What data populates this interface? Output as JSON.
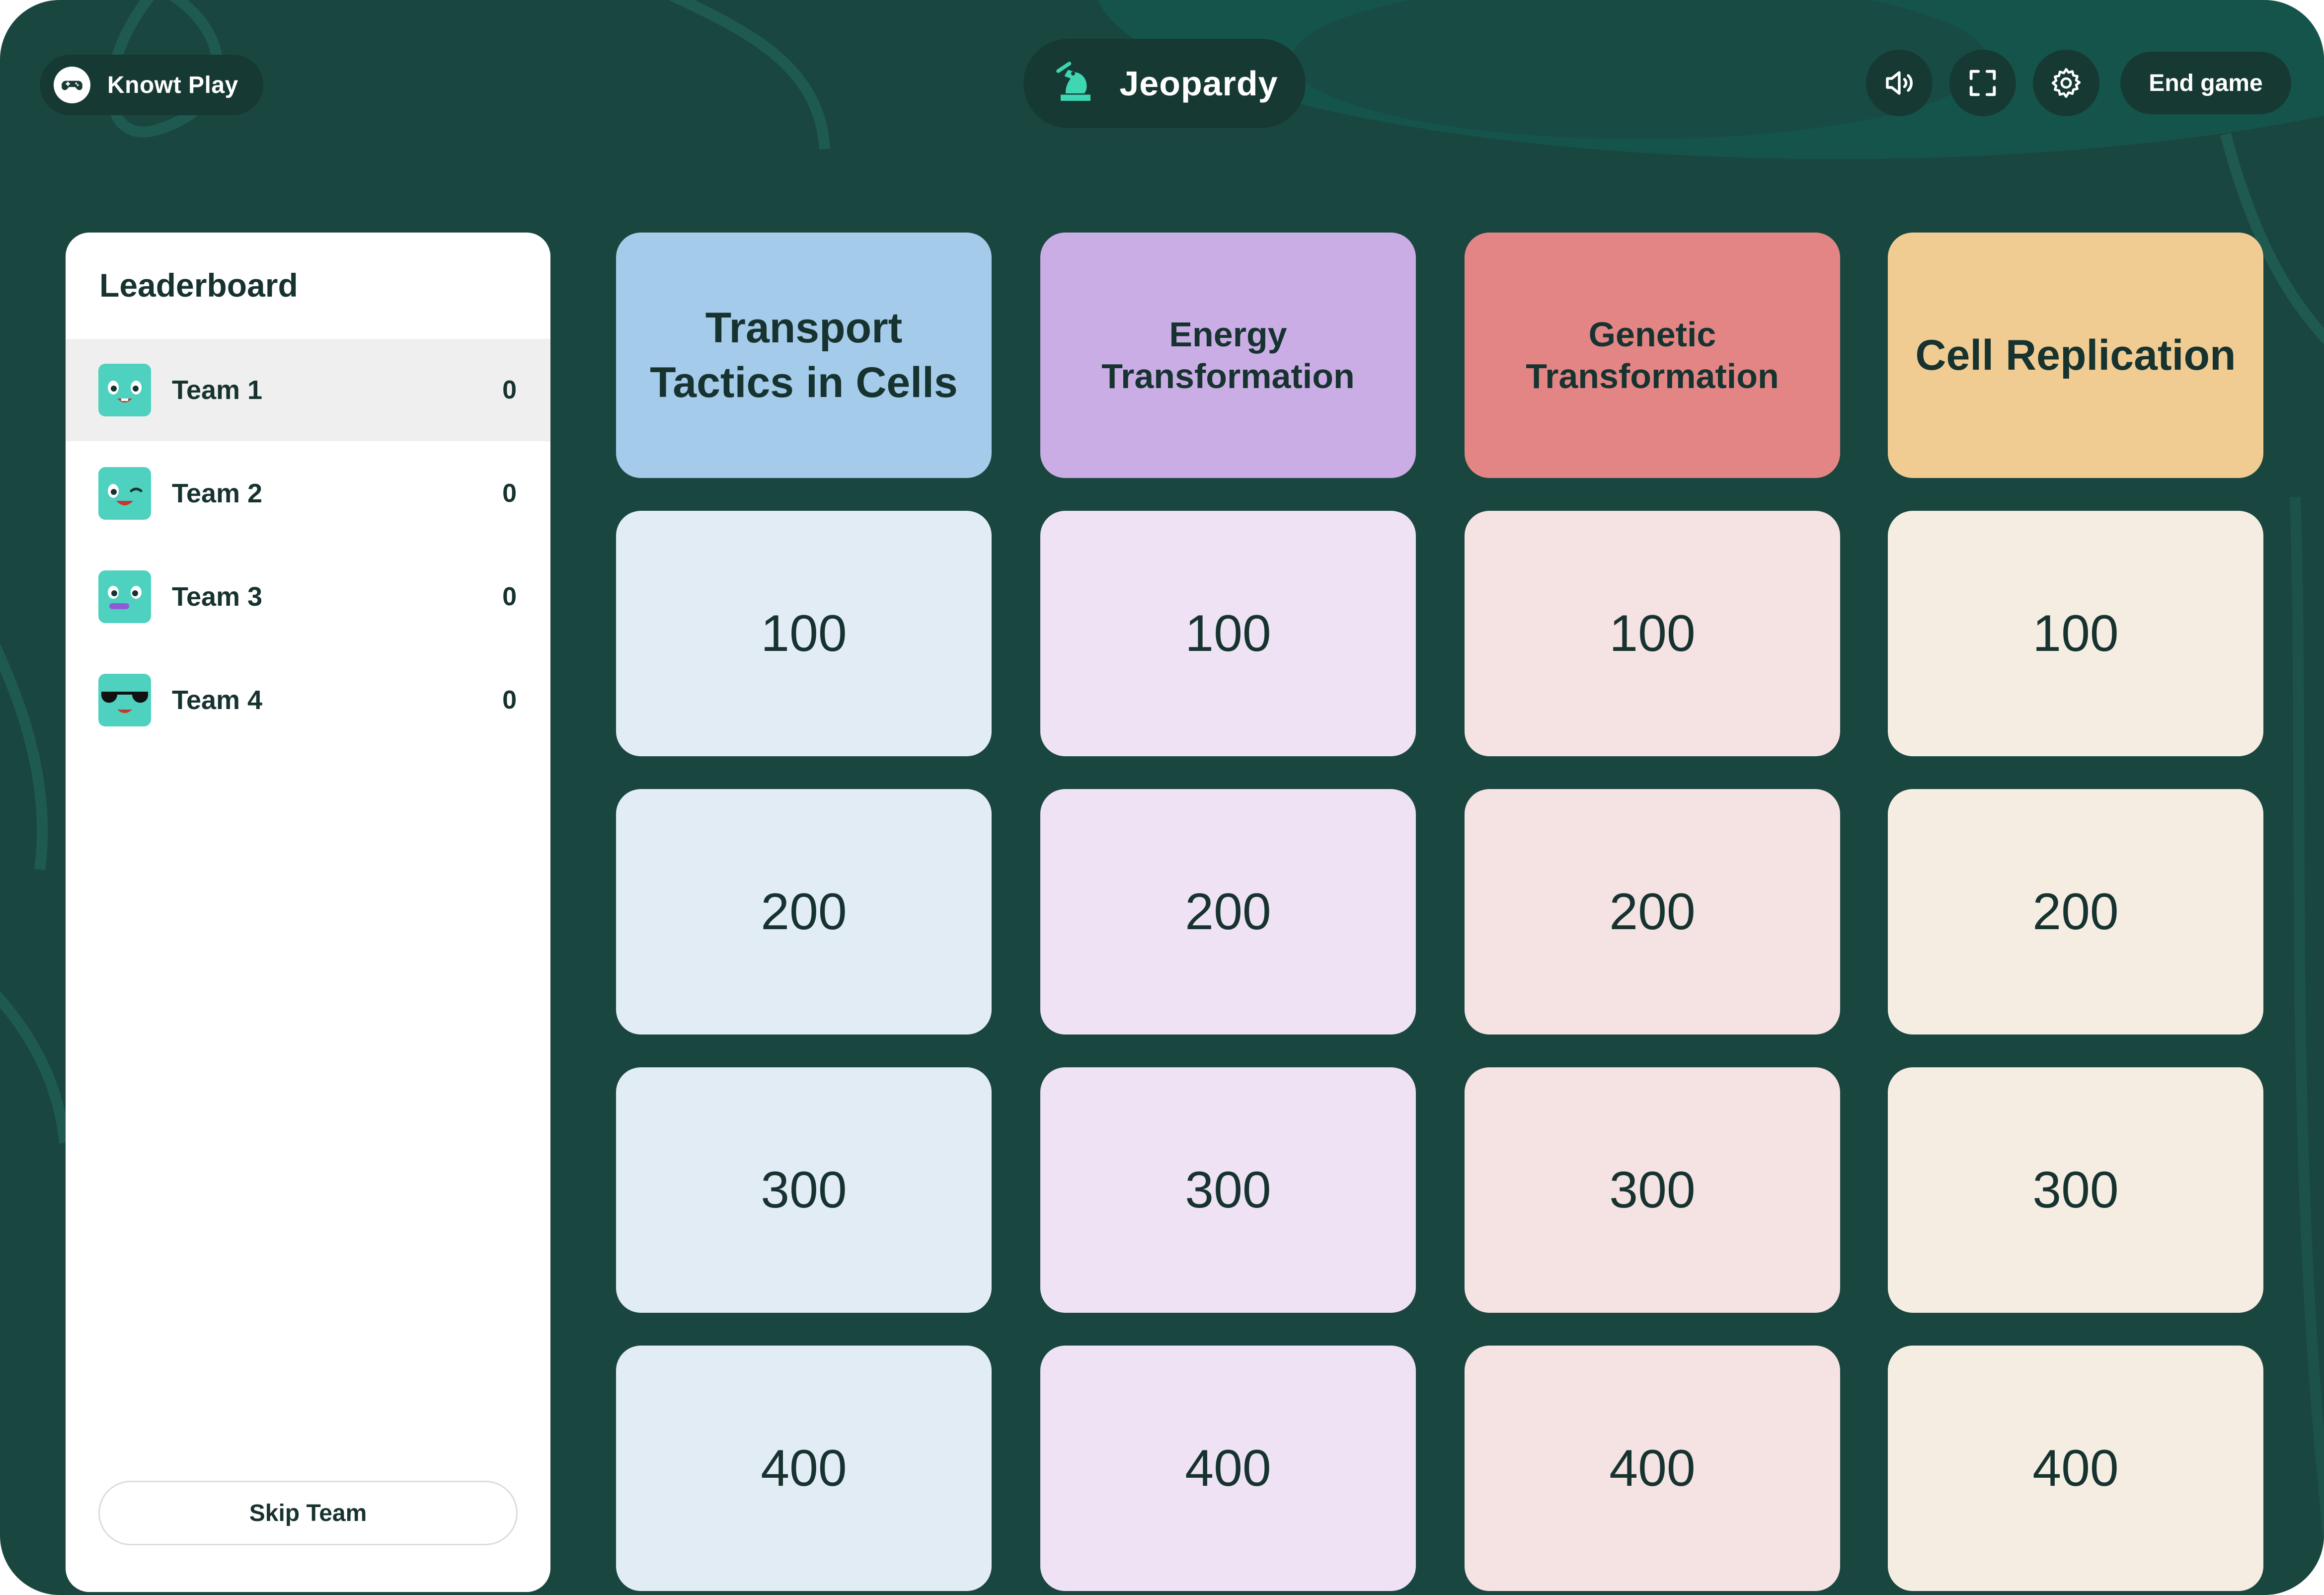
{
  "header": {
    "brand_label": "Knowt Play",
    "game_title": "Jeopardy",
    "end_game_label": "End game",
    "icons": [
      "gamepad-icon",
      "chess-knight-icon",
      "speaker-icon",
      "fullscreen-icon",
      "gear-icon"
    ]
  },
  "leaderboard": {
    "title": "Leaderboard",
    "teams": [
      {
        "name": "Team 1",
        "score": "0",
        "active": true
      },
      {
        "name": "Team 2",
        "score": "0",
        "active": false
      },
      {
        "name": "Team 3",
        "score": "0",
        "active": false
      },
      {
        "name": "Team 4",
        "score": "0",
        "active": false
      }
    ],
    "skip_label": "Skip Team"
  },
  "board": {
    "categories": [
      {
        "title": "Transport Tactics in Cells",
        "color": "#a5cbea"
      },
      {
        "title": "Energy Transformation",
        "color": "#cbade6"
      },
      {
        "title": "Genetic Transformation",
        "color": "#e38585"
      },
      {
        "title": "Cell Replication",
        "color": "#f0cc92"
      }
    ],
    "values": [
      "100",
      "200",
      "300",
      "400"
    ]
  },
  "colors": {
    "background": "#1a4640",
    "panel_dark": "#163a33",
    "text": "#173330",
    "avatar": "#4fd1bf"
  }
}
